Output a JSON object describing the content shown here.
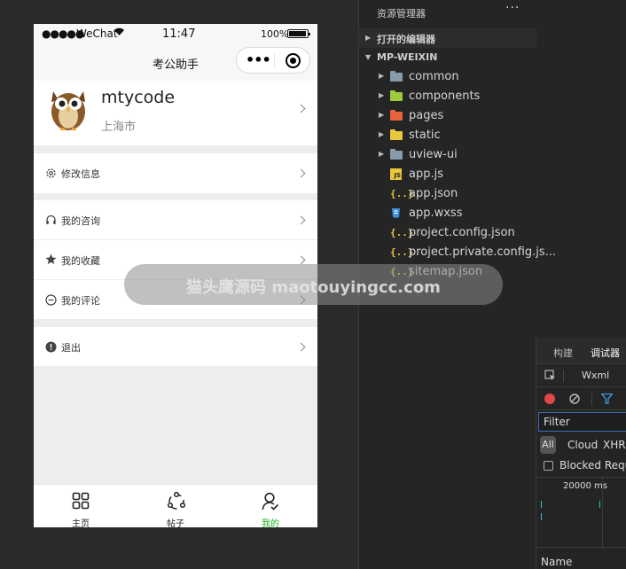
{
  "phone": {
    "status": {
      "signal": "●●●●●",
      "carrier": "WeChat",
      "time": "11:47",
      "battery": "100%"
    },
    "nav_title": "考公助手",
    "profile": {
      "name": "mtycode",
      "city": "上海市"
    },
    "menu": {
      "edit_info": "修改信息",
      "consult": "我的咨询",
      "favorites": "我的收藏",
      "comments": "我的评论",
      "logout": "退出"
    },
    "tabbar": [
      {
        "label": "主页",
        "icon": "grid-icon"
      },
      {
        "label": "帖子",
        "icon": "share-icon"
      },
      {
        "label": "我的",
        "icon": "user-icon",
        "active": true
      }
    ],
    "active_color": "#1aad19"
  },
  "watermark": "猫头鹰源码 maotouyingcc.com",
  "explorer": {
    "title": "资源管理器",
    "more": "···",
    "open_editors": "打开的编辑器",
    "project": "MP-WEIXIN",
    "items": [
      {
        "name": "common",
        "type": "folder",
        "color": "#8a9ba8"
      },
      {
        "name": "components",
        "type": "folder",
        "color": "#9ccc3c"
      },
      {
        "name": "pages",
        "type": "folder",
        "color": "#e8623c"
      },
      {
        "name": "static",
        "type": "folder",
        "color": "#e8c83c"
      },
      {
        "name": "uview-ui",
        "type": "folder",
        "color": "#8a9ba8"
      },
      {
        "name": "app.js",
        "type": "js"
      },
      {
        "name": "app.json",
        "type": "json"
      },
      {
        "name": "app.wxss",
        "type": "wxss"
      },
      {
        "name": "project.config.json",
        "type": "json"
      },
      {
        "name": "project.private.config.js...",
        "type": "json"
      },
      {
        "name": "sitemap.json",
        "type": "json"
      }
    ]
  },
  "devtools": {
    "tabs": {
      "build": "构建",
      "debugger": "调试器"
    },
    "wxml": "Wxml",
    "filter": "Filter",
    "types": {
      "all": "All",
      "cloud": "Cloud",
      "xhr": "XHR"
    },
    "blocked": "Blocked Reque",
    "time_label": "20000 ms",
    "name_header": "Name"
  }
}
